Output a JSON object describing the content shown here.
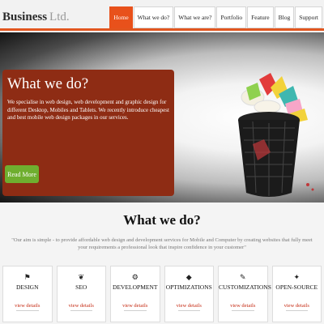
{
  "header": {
    "logo_main": "Business",
    "logo_suffix": "Ltd.",
    "nav": [
      "Home",
      "What we do?",
      "What we are?",
      "Portfolio",
      "Feature",
      "Blog",
      "Support"
    ],
    "active_nav": "Home",
    "accent_color": "#e8511b"
  },
  "hero": {
    "title": "What we do?",
    "text": "We specialise in web design, web development and graphic design for different Desktop, Mobiles and Tablets. We recently introduce cheapest and best mobile web design packages in our services.",
    "button_label": "Read More",
    "box_color": "#8e2c14",
    "button_color": "#6fae2f"
  },
  "section": {
    "title": "What we do?",
    "text": "\"Our aim is simple - to provide affordable web design and development services for Mobile and Computer by creating websites that fully meet your requirements a professional look that inspire confidence in your customer\""
  },
  "services": [
    {
      "label": "DESIGN",
      "icon": "⚑",
      "link": "view details"
    },
    {
      "label": "SEO",
      "icon": "❦",
      "link": "view details"
    },
    {
      "label": "DEVELOPMENT",
      "icon": "⚙",
      "link": "view details"
    },
    {
      "label": "OPTIMIZATIONS",
      "icon": "◆",
      "link": "view details"
    },
    {
      "label": "CUSTOMIZATIONS",
      "icon": "✎",
      "link": "view details"
    },
    {
      "label": "OPEN-SOURCE",
      "icon": "✦",
      "link": "view details"
    }
  ]
}
